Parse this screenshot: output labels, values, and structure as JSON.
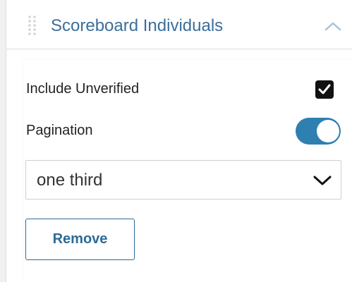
{
  "panel": {
    "title": "Scoreboard Individuals"
  },
  "options": {
    "include_unverified": {
      "label": "Include Unverified",
      "checked": true
    },
    "pagination": {
      "label": "Pagination",
      "enabled": true
    }
  },
  "size_select": {
    "value": "one third"
  },
  "actions": {
    "remove_label": "Remove"
  },
  "colors": {
    "accent": "#2d80b0",
    "title": "#3b6f9a",
    "button_border": "#2d6a96"
  }
}
